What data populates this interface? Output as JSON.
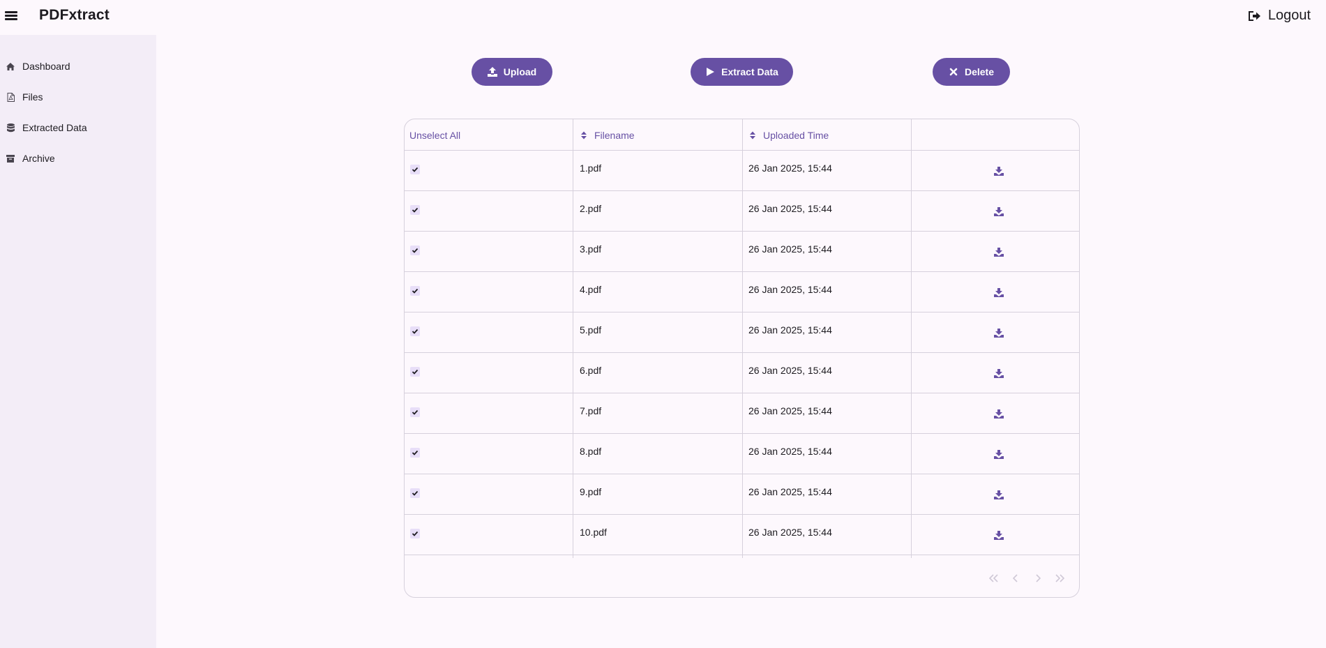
{
  "app": {
    "title": "PDFxtract"
  },
  "header": {
    "logout_label": "Logout"
  },
  "sidebar": {
    "items": [
      {
        "label": "Dashboard",
        "icon": "home-icon"
      },
      {
        "label": "Files",
        "icon": "file-pdf-icon"
      },
      {
        "label": "Extracted Data",
        "icon": "database-icon"
      },
      {
        "label": "Archive",
        "icon": "archive-icon"
      }
    ]
  },
  "toolbar": {
    "upload_label": "Upload",
    "extract_label": "Extract Data",
    "delete_label": "Delete"
  },
  "table": {
    "headers": {
      "select": "Unselect All",
      "filename": "Filename",
      "uploaded": "Uploaded Time"
    },
    "rows": [
      {
        "checked": true,
        "filename": "1.pdf",
        "uploaded": "26 Jan 2025, 15:44"
      },
      {
        "checked": true,
        "filename": "2.pdf",
        "uploaded": "26 Jan 2025, 15:44"
      },
      {
        "checked": true,
        "filename": "3.pdf",
        "uploaded": "26 Jan 2025, 15:44"
      },
      {
        "checked": true,
        "filename": "4.pdf",
        "uploaded": "26 Jan 2025, 15:44"
      },
      {
        "checked": true,
        "filename": "5.pdf",
        "uploaded": "26 Jan 2025, 15:44"
      },
      {
        "checked": true,
        "filename": "6.pdf",
        "uploaded": "26 Jan 2025, 15:44"
      },
      {
        "checked": true,
        "filename": "7.pdf",
        "uploaded": "26 Jan 2025, 15:44"
      },
      {
        "checked": true,
        "filename": "8.pdf",
        "uploaded": "26 Jan 2025, 15:44"
      },
      {
        "checked": true,
        "filename": "9.pdf",
        "uploaded": "26 Jan 2025, 15:44"
      },
      {
        "checked": true,
        "filename": "10.pdf",
        "uploaded": "26 Jan 2025, 15:44"
      }
    ]
  },
  "colors": {
    "accent": "#6750a4",
    "sidebar_bg": "#f3edf7",
    "page_bg": "#fdf8fd",
    "border": "#d6d0dc"
  }
}
